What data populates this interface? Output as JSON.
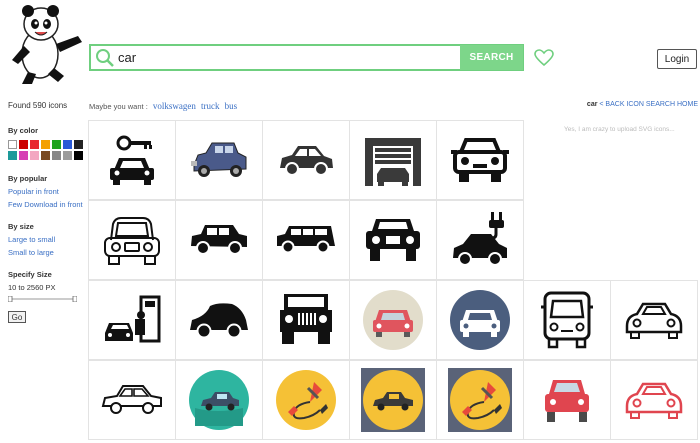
{
  "search": {
    "value": "car",
    "button_label": "SEARCH"
  },
  "header": {
    "login_label": "Login"
  },
  "results": {
    "found_text": "Found 590 icons"
  },
  "suggestions": {
    "prefix": "Maybe you want :",
    "items": [
      "volkswagen",
      "truck",
      "bus"
    ]
  },
  "breadcrumb": {
    "term": "car",
    "sep": " < ",
    "link": "BACK ICON SEARCH HOME"
  },
  "upload_note": "Yes, I am crazy to upload SVG icons...",
  "sidebar": {
    "by_color": "By color",
    "colors": [
      "#ffffff",
      "#cc0000",
      "#e8262e",
      "#f4a000",
      "#1fa31f",
      "#2b5ad6",
      "#222222",
      "#1d9a9a",
      "#d63fb4",
      "#f3a7c1",
      "#7a4a20",
      "#888888",
      "#9b9b9b",
      "#000000"
    ],
    "by_popular": "By popular",
    "popular_items": [
      "Popular in front",
      "Few Download in front"
    ],
    "by_size": "By size",
    "size_items": [
      "Large to small",
      "Small to large"
    ],
    "specify_size": "Specify Size",
    "size_range": "10 to 2560 PX",
    "go_label": "Go"
  },
  "icons": [
    "car-key-icon",
    "vintage-car-icon",
    "hatchback-car-icon",
    "garage-car-icon",
    "car-front-outline-icon",
    "car-front-line-icon",
    "suv-side-icon",
    "jeep-side-icon",
    "car-front-black-icon",
    "electric-car-icon",
    "car-service-icon",
    "compact-car-side-icon",
    "jeep-front-icon",
    "car-red-circle-icon",
    "car-white-circle-icon",
    "bus-front-outline-icon",
    "sports-car-outline-icon",
    "sedan-outline-icon",
    "car-teal-circle-icon",
    "jumper-cables-circle-icon",
    "car-yellow-circle-icon",
    "jumper-cables-yellow-icon",
    "car-red-front-icon",
    "sports-car-red-outline-icon"
  ]
}
